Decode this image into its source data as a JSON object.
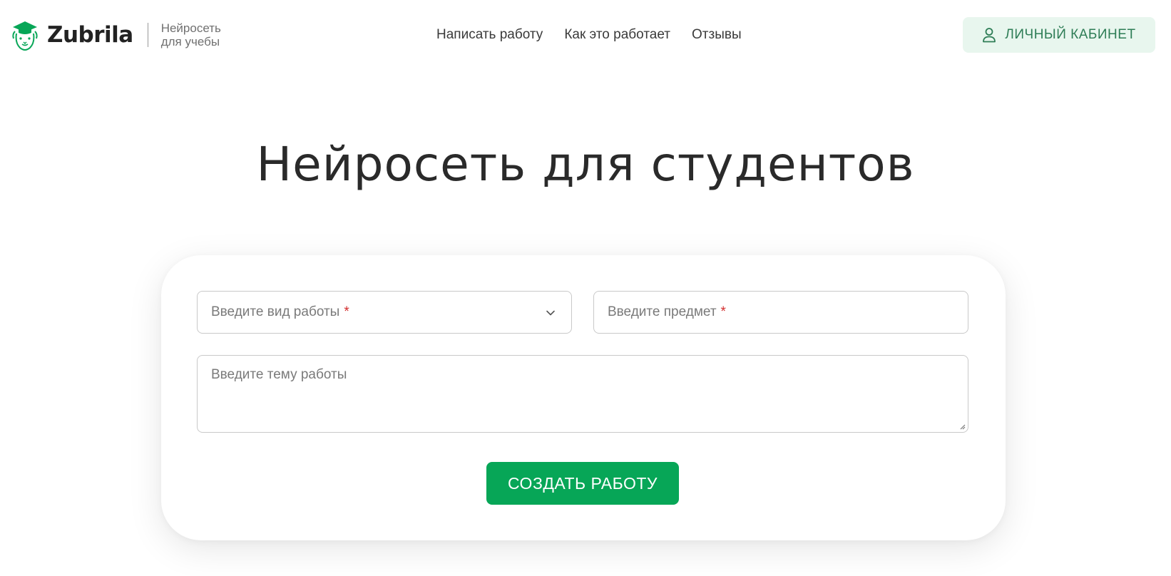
{
  "header": {
    "logo_text": "Zubrila",
    "tagline_line1": "Нейросеть",
    "tagline_line2": "для учебы",
    "logo_icon": "bison-graduate-icon",
    "nav": [
      {
        "label": "Написать работу"
      },
      {
        "label": "Как это работает"
      },
      {
        "label": "Отзывы"
      }
    ],
    "cabinet_label": "ЛИЧНЫЙ КАБИНЕТ",
    "cabinet_icon": "user-icon"
  },
  "hero": {
    "title": "Нейросеть для студентов"
  },
  "form": {
    "work_type_placeholder": "Введите вид работы",
    "subject_placeholder": "Введите предмет",
    "required_mark": "*",
    "topic_placeholder": "Введите тему работы",
    "submit_label": "СОЗДАТЬ РАБОТУ"
  },
  "colors": {
    "brand_green": "#07a657",
    "cabinet_bg": "#e8f6ee",
    "cabinet_text": "#2e7d56",
    "required_red": "#d32f2f"
  }
}
